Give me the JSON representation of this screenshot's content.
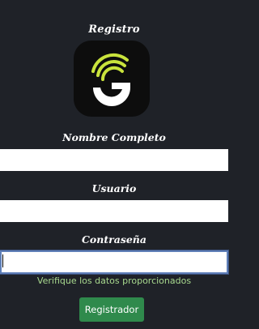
{
  "header": {
    "title": "Registro"
  },
  "logo": {
    "icon": "g-wifi-logo-icon",
    "colors": {
      "background": "#0d0d0d",
      "letter": "#ffffff",
      "arcs": "#c9e33c"
    }
  },
  "form": {
    "fullname_label": "Nombre Completo",
    "fullname_value": "",
    "username_label": "Usuario",
    "username_value": "",
    "password_label": "Contraseña",
    "password_value": ""
  },
  "status": {
    "message": "Verifique los datos proporcionados",
    "color": "#a8d98e"
  },
  "actions": {
    "submit_label": "Registrador",
    "submit_color": "#2f8a4c"
  }
}
